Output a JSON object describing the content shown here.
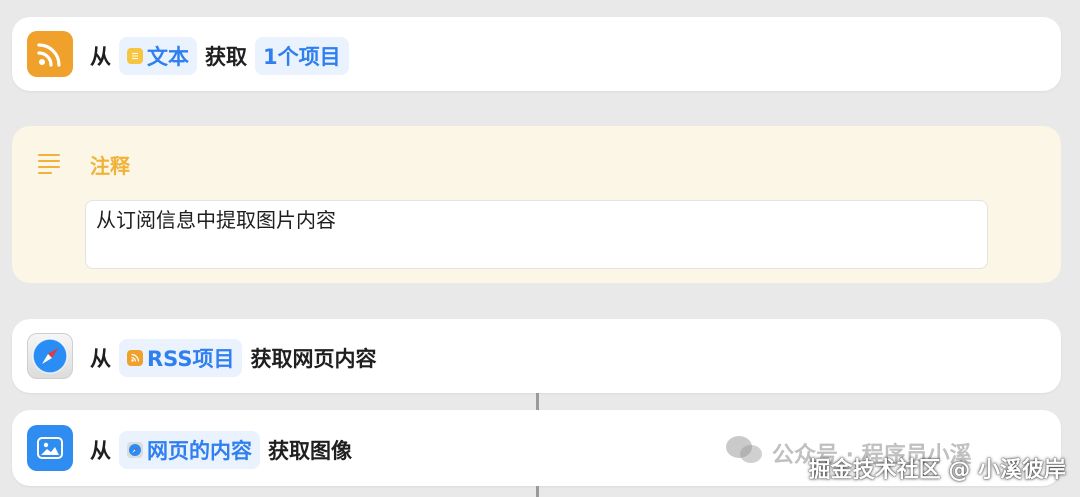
{
  "rows": {
    "row1": {
      "from": "从",
      "pill_label": "文本",
      "verb": "获取",
      "pill2_label": "1个项目",
      "icon": "rss-icon"
    },
    "row2": {
      "from": "从",
      "pill_label": "RSS项目",
      "verb": "获取网页内容",
      "icon": "safari-icon"
    },
    "row3": {
      "from": "从",
      "pill_label": "网页的内容",
      "verb": "获取图像",
      "icon": "photo-icon"
    }
  },
  "comment": {
    "title": "注释",
    "text": "从订阅信息中提取图片内容",
    "icon": "lines-icon"
  },
  "watermarks": {
    "wechat": "公众号 · 程序员小溪",
    "juejin": "掘金技术社区 @ 小溪彼岸"
  },
  "colors": {
    "accent": "#2f7ff0",
    "rss": "#f0a12c",
    "comment": "#f1b23a",
    "photo": "#2f8cf0"
  }
}
